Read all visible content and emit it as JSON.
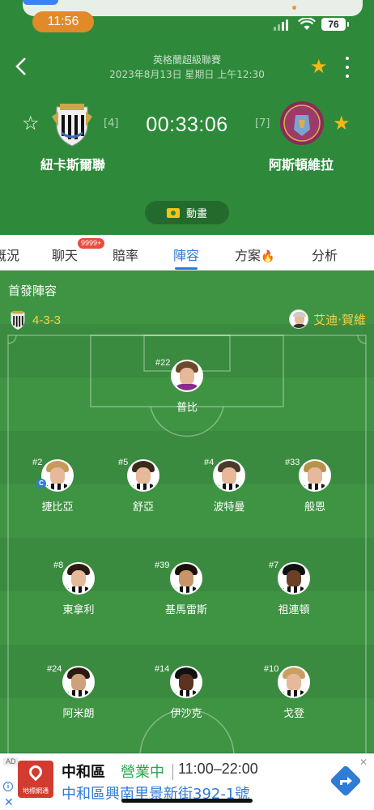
{
  "status_bar": {
    "time": "11:56",
    "battery": "76"
  },
  "match": {
    "league": "英格蘭超級聯賽",
    "date": "2023年8月13日 星期日 上午12:30",
    "clock": "00:33:06",
    "home": {
      "name": "紐卡斯爾聯",
      "rank": "[4]"
    },
    "away": {
      "name": "阿斯頓維拉",
      "rank": "[7]"
    },
    "animation_label": "動畫"
  },
  "tabs": [
    {
      "label": "概況"
    },
    {
      "label": "聊天",
      "badge": "9999+"
    },
    {
      "label": "賠率"
    },
    {
      "label": "陣容",
      "active": true
    },
    {
      "label": "方案"
    },
    {
      "label": "分析"
    }
  ],
  "lineup": {
    "title": "首發陣容",
    "formation": "4-3-3",
    "manager": "艾迪·賀維",
    "players": [
      {
        "number": "#22",
        "name": "普比"
      },
      {
        "number": "#2",
        "name": "捷比亞",
        "captain": "C"
      },
      {
        "number": "#5",
        "name": "舒亞"
      },
      {
        "number": "#4",
        "name": "波特曼"
      },
      {
        "number": "#33",
        "name": "般恩"
      },
      {
        "number": "#8",
        "name": "東拿利"
      },
      {
        "number": "#39",
        "name": "基馬雷斯"
      },
      {
        "number": "#7",
        "name": "祖連頓"
      },
      {
        "number": "#24",
        "name": "阿米朗"
      },
      {
        "number": "#14",
        "name": "伊沙克"
      },
      {
        "number": "#10",
        "name": "戈登"
      }
    ]
  },
  "ad": {
    "tag": "AD",
    "logo_text": "地標網通",
    "name": "中和區",
    "status": "營業中",
    "hours": "11:00–22:00",
    "address": "中和區興南里景新街392-1號"
  },
  "colors": {
    "header_green": "#2e8a3a",
    "accent_blue": "#2f7bd6",
    "star_gold": "#f5b718",
    "formation_yellow": "#f5d04a"
  }
}
